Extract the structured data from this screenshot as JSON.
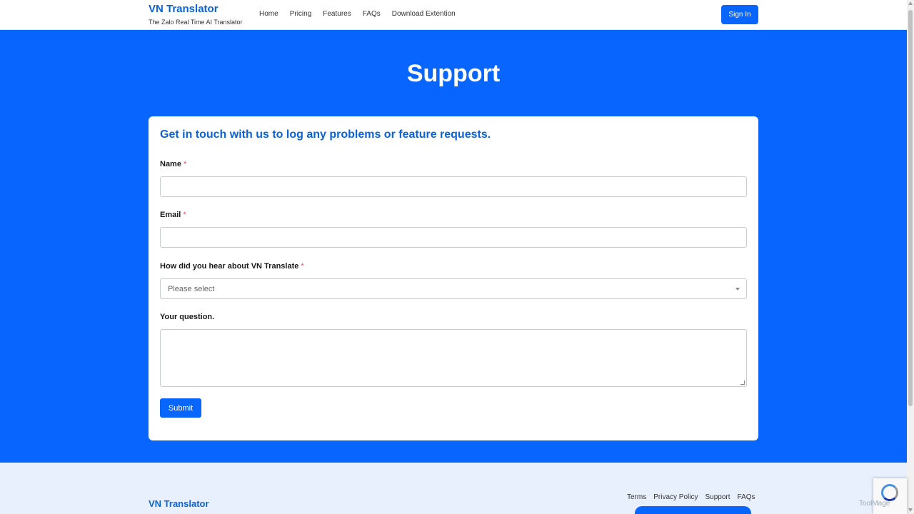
{
  "header": {
    "brand_title": "VN Translator",
    "brand_subtitle": "The Zalo Real Time AI Translator",
    "nav": [
      "Home",
      "Pricing",
      "Features",
      "FAQs",
      "Download Extention"
    ],
    "signin_label": "Sign In"
  },
  "hero": {
    "title": "Support"
  },
  "form": {
    "heading": "Get in touch with us to log any problems or feature requests.",
    "name_label": "Name",
    "email_label": "Email",
    "source_label": "How did you hear about VN Translate",
    "source_placeholder": "Please select",
    "question_label": "Your question.",
    "required_mark": "*",
    "submit_label": "Submit"
  },
  "footer": {
    "brand": "VN Translator",
    "links": [
      "Terms",
      "Privacy Policy",
      "Support",
      "FAQs"
    ]
  },
  "watermark": "ToolMage",
  "colors": {
    "primary": "#0866ff",
    "brand_text": "#0a63d6",
    "footer_bg": "#e8f0fe"
  }
}
